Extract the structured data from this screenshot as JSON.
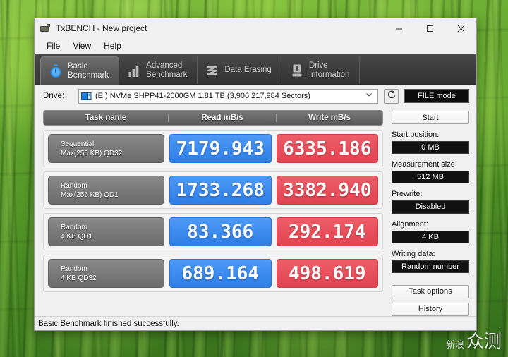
{
  "desktop": {
    "wallpaper_name": "bamboo-forest-wallpaper",
    "watermark_small": "新浪",
    "watermark_large": "众测"
  },
  "window": {
    "title": "TxBENCH - New project",
    "icon": "app-icon",
    "controls": {
      "minimize": "minimize-icon",
      "maximize": "maximize-icon",
      "close": "close-icon"
    }
  },
  "menu": {
    "items": [
      {
        "label": "File"
      },
      {
        "label": "View"
      },
      {
        "label": "Help"
      }
    ]
  },
  "tabs": [
    {
      "line1": "Basic",
      "line2": "Benchmark",
      "icon": "stopwatch-icon",
      "active": true
    },
    {
      "line1": "Advanced",
      "line2": "Benchmark",
      "icon": "bar-chart-icon",
      "active": false
    },
    {
      "line1": "Data Erasing",
      "line2": "",
      "icon": "shred-icon",
      "active": false
    },
    {
      "line1": "Drive",
      "line2": "Information",
      "icon": "drive-info-icon",
      "active": false
    }
  ],
  "drive": {
    "caption": "Drive:",
    "value": "(E:) NVMe SHPP41-2000GM  1.81 TB (3,906,217,984 Sectors)",
    "glyph": "hard-drive-icon",
    "chevron": "chevron-down-icon",
    "refresh_icon": "refresh-icon",
    "file_mode_label": "FILE mode"
  },
  "results": {
    "headers": {
      "task": "Task name",
      "read": "Read mB/s",
      "write": "Write mB/s"
    },
    "rows": [
      {
        "task_line1": "Sequential",
        "task_line2": "Max(256 KB) QD32",
        "read": "7179.943",
        "write": "6335.186"
      },
      {
        "task_line1": "Random",
        "task_line2": "Max(256 KB) QD1",
        "read": "1733.268",
        "write": "3382.940"
      },
      {
        "task_line1": "Random",
        "task_line2": "4 KB QD1",
        "read": "83.366",
        "write": "292.174"
      },
      {
        "task_line1": "Random",
        "task_line2": "4 KB QD32",
        "read": "689.164",
        "write": "498.619"
      }
    ]
  },
  "sidebar": {
    "start_label": "Start",
    "fields": [
      {
        "label": "Start position:",
        "value": "0 MB"
      },
      {
        "label": "Measurement size:",
        "value": "512 MB"
      },
      {
        "label": "Prewrite:",
        "value": "Disabled"
      },
      {
        "label": "Alignment:",
        "value": "4 KB"
      },
      {
        "label": "Writing data:",
        "value": "Random number"
      }
    ],
    "task_options_label": "Task options",
    "history_label": "History"
  },
  "status": {
    "text": "Basic Benchmark finished successfully."
  },
  "colors": {
    "read_blue": "#3d8bee",
    "write_red": "#e8505c",
    "tab_strip": "#3c3c3c",
    "accent_icon_blue": "#2f8fe0",
    "value_black": "#111111"
  }
}
